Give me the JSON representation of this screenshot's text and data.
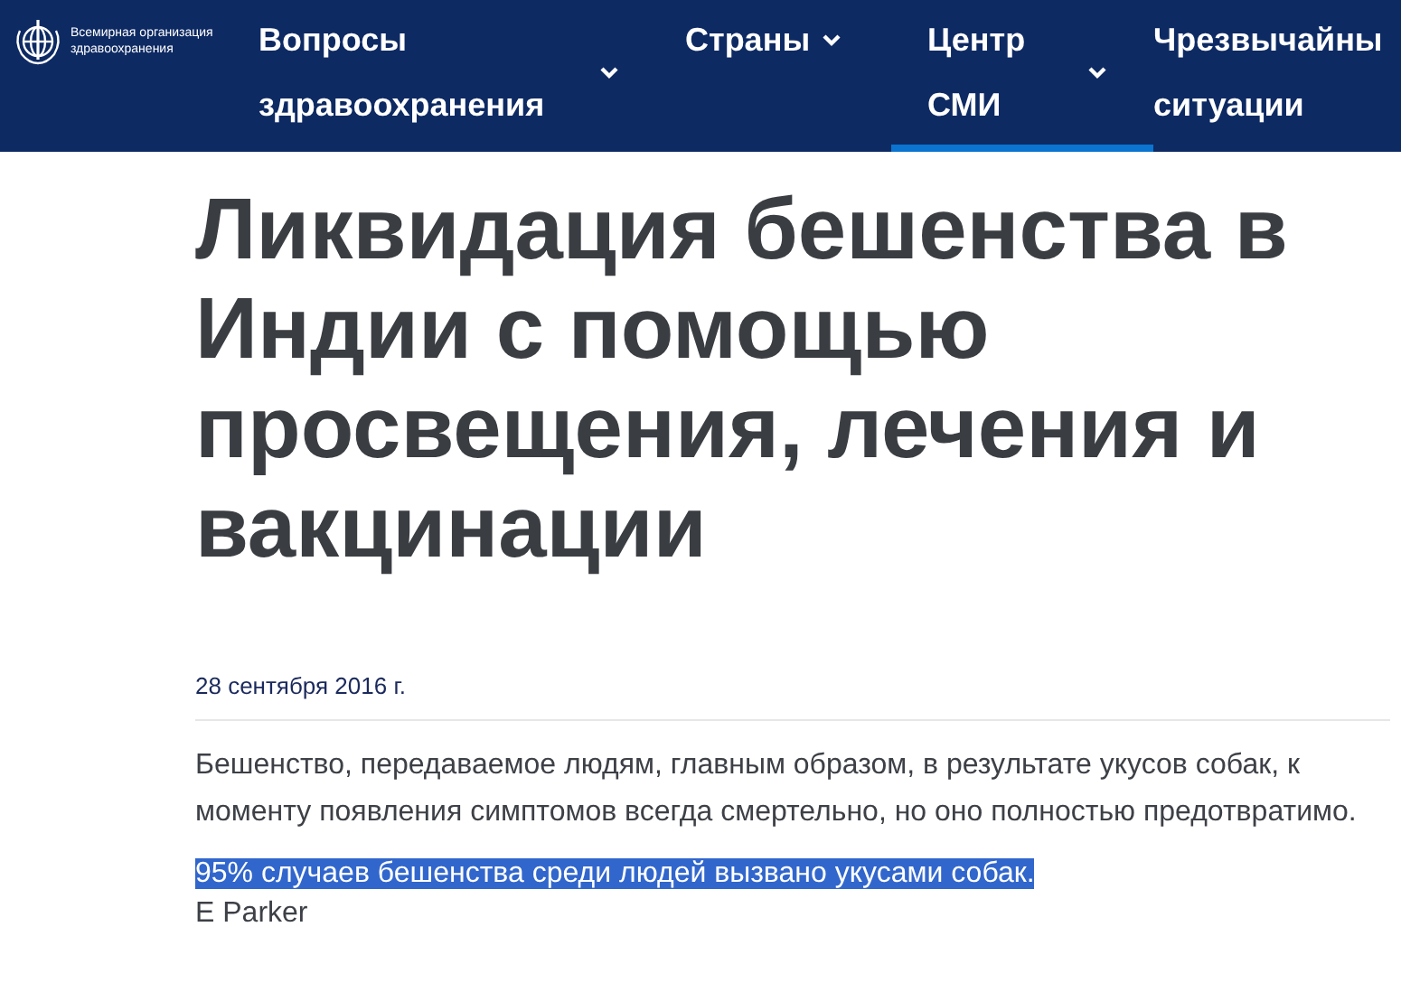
{
  "header": {
    "logo_text": "Всемирная организация здравоохранения",
    "nav": [
      {
        "label": "Вопросы здравоохранения",
        "has_dropdown": true,
        "selected": false
      },
      {
        "label": "Страны",
        "has_dropdown": true,
        "selected": false
      },
      {
        "label": "Центр СМИ",
        "has_dropdown": true,
        "selected": true
      },
      {
        "label": "Чрезвычайны ситуации",
        "selected": false
      }
    ]
  },
  "article": {
    "title": "Ликвидация бешенства в Индии с помощью просвещения, лечения и вакцинации",
    "date": "28 сентября 2016 г.",
    "lead": "Бешенство, передаваемое людям, главным образом, в результате укусов собак, к моменту появления симптомов всегда смертельно, но оно полностью предотвратимо.",
    "caption": {
      "text": "95% случаев бешенства среди людей вызвано укусами собак.",
      "highlighted": true
    },
    "credit": "E Parker"
  }
}
